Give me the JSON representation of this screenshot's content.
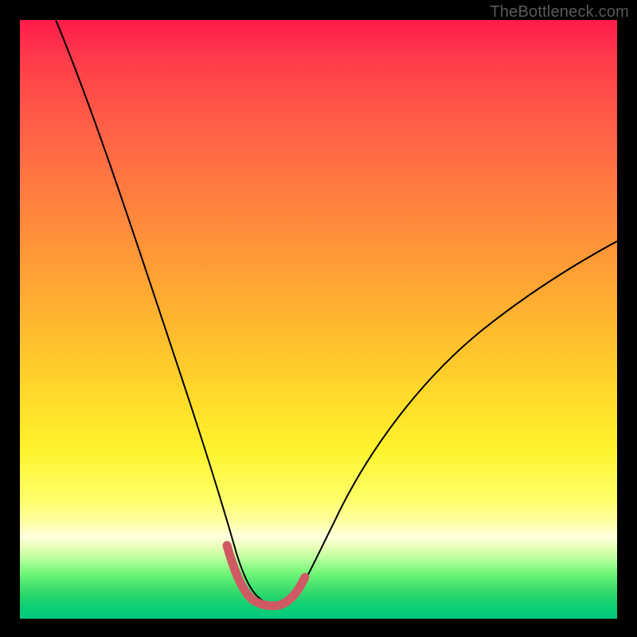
{
  "watermark": "TheBottleneck.com",
  "chart_data": {
    "type": "line",
    "title": "",
    "xlabel": "",
    "ylabel": "",
    "xlim": [
      0,
      100
    ],
    "ylim": [
      0,
      100
    ],
    "annotations": [],
    "series": [
      {
        "name": "bottleneck-curve",
        "x": [
          6,
          10,
          14,
          18,
          22,
          26,
          29,
          32,
          34,
          35.5,
          37,
          39,
          41,
          43,
          45,
          47,
          52,
          58,
          66,
          76,
          88,
          100
        ],
        "y": [
          100,
          89,
          77,
          65,
          53,
          41,
          30,
          20,
          13,
          9,
          6,
          4,
          3,
          3,
          4,
          6,
          10,
          16,
          25,
          35,
          46,
          56
        ],
        "stroke": "#000000",
        "stroke_width_px": 2
      },
      {
        "name": "highlight-segment",
        "x": [
          34.5,
          36,
          37.5,
          39,
          41,
          43,
          45,
          46.2,
          47.4
        ],
        "y": [
          10,
          7,
          5,
          4,
          3,
          3,
          4,
          5.4,
          7
        ],
        "stroke": "#cf5a63",
        "stroke_width_px": 11,
        "cap": "round"
      }
    ],
    "background_gradient": {
      "type": "vertical",
      "stops": [
        {
          "pos": 0.0,
          "color": "#ff1a4a"
        },
        {
          "pos": 0.5,
          "color": "#ffbb2e"
        },
        {
          "pos": 0.8,
          "color": "#ffff68"
        },
        {
          "pos": 0.88,
          "color": "#e9ffb8"
        },
        {
          "pos": 1.0,
          "color": "#05c97f"
        }
      ]
    }
  }
}
